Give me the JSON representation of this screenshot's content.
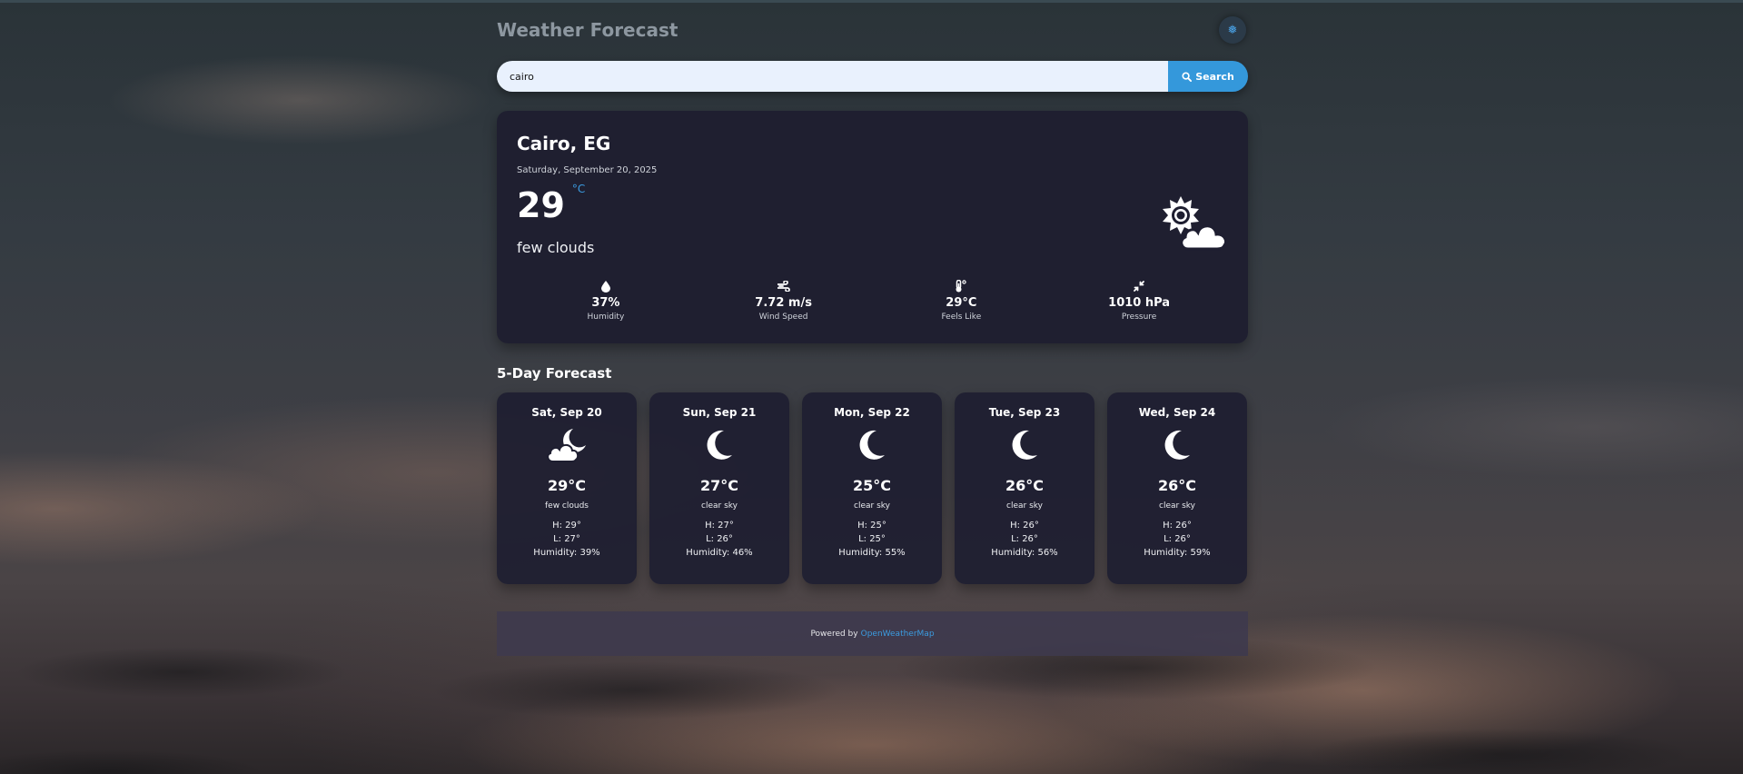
{
  "app": {
    "title": "Weather Forecast"
  },
  "search": {
    "value": "cairo",
    "button_label": "Search"
  },
  "current": {
    "location": "Cairo, EG",
    "date": "Saturday, September 20, 2025",
    "temperature": "29",
    "unit": "°C",
    "description": "few clouds",
    "icon": "sun-cloud-icon",
    "stats": [
      {
        "icon": "droplet-icon",
        "value": "37%",
        "label": "Humidity"
      },
      {
        "icon": "wind-icon",
        "value": "7.72 m/s",
        "label": "Wind Speed"
      },
      {
        "icon": "thermometer-icon",
        "value": "29°C",
        "label": "Feels Like"
      },
      {
        "icon": "compress-icon",
        "value": "1010 hPa",
        "label": "Pressure"
      }
    ]
  },
  "forecast": {
    "title": "5-Day Forecast",
    "days": [
      {
        "day": "Sat, Sep 20",
        "icon": "moon-cloud-icon",
        "temp": "29°C",
        "desc": "few clouds",
        "high": "H: 29°",
        "low": "L: 27°",
        "humidity": "Humidity: 39%"
      },
      {
        "day": "Sun, Sep 21",
        "icon": "moon-icon",
        "temp": "27°C",
        "desc": "clear sky",
        "high": "H: 27°",
        "low": "L: 26°",
        "humidity": "Humidity: 46%"
      },
      {
        "day": "Mon, Sep 22",
        "icon": "moon-icon",
        "temp": "25°C",
        "desc": "clear sky",
        "high": "H: 25°",
        "low": "L: 25°",
        "humidity": "Humidity: 55%"
      },
      {
        "day": "Tue, Sep 23",
        "icon": "moon-icon",
        "temp": "26°C",
        "desc": "clear sky",
        "high": "H: 26°",
        "low": "L: 26°",
        "humidity": "Humidity: 56%"
      },
      {
        "day": "Wed, Sep 24",
        "icon": "moon-icon",
        "temp": "26°C",
        "desc": "clear sky",
        "high": "H: 26°",
        "low": "L: 26°",
        "humidity": "Humidity: 59%"
      }
    ]
  },
  "footer": {
    "prefix": "Powered by",
    "link_label": "OpenWeatherMap"
  },
  "colors": {
    "accent": "#3498db",
    "card": "#1e1e30",
    "input_bg": "#e9f1fd"
  }
}
